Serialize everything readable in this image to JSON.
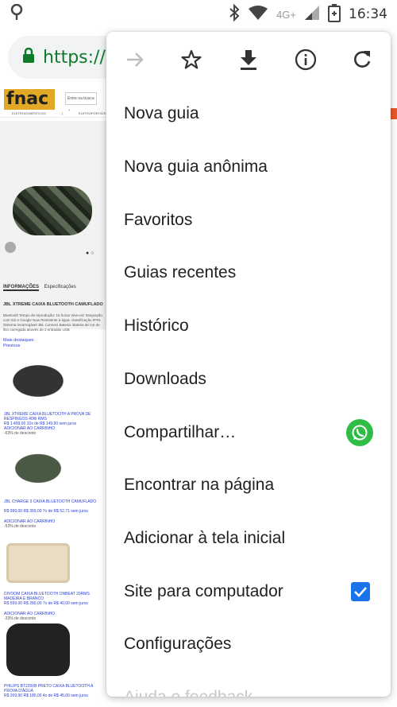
{
  "status_bar": {
    "time": "16:34",
    "network": "4G+",
    "icons": [
      "location-icon",
      "bluetooth-icon",
      "wifi-icon",
      "signal-icon",
      "battery-charging-icon"
    ]
  },
  "address_bar": {
    "url": "https://",
    "secure_icon": "lock-icon"
  },
  "page": {
    "logo": "fnac",
    "search_label": "Entre na busca ⌄",
    "nav": [
      "ELETRODOMÉSTICOS",
      "|",
      "ELETROPORTÁTEIS",
      "|"
    ],
    "tabs": [
      "INFORMAÇÕES",
      "Especificações"
    ],
    "product_title": "JBL XTREME CAIXA BLUETOOTH CAMUFLADO",
    "product_desc": "Bluetooth Tempo de reprodução: 15 horas Viva-voz Integração com Siri e Google Now Resistente à água: classificação IPX5 Sistema recarregável JBL Connect Bateria: Bateria de íon de lítio carregada através de 2 entradas USB",
    "links": [
      "Mais destaques",
      "Previous"
    ],
    "items": [
      {
        "text": "JBL XTREME CAIXA BLUETOOTH A PROVA DE RESPINGOS 40W RMS",
        "price": "R$ 1.499,00 10x de R$ 149,90 sem juros",
        "cart": "ADICIONAR AO CARRINHO",
        "discount": "-63% de desconto"
      },
      {
        "text": "JBL CHARGE 3 CAIXA BLUETOOTH CAMUFLADO",
        "price": "R$ 999,00 R$ 369,00 7x de R$ 52,71 sem juros",
        "cart": "ADICIONAR AO CARRINHO",
        "discount": "-53% de desconto"
      },
      {
        "text": "DIVOOM CAIXA BLUETOOTH ONBEAT 20RMS MADEIRA E BRANCO",
        "price": "R$ 599,00 R$ 280,00 7x de R$ 40,00 sem juros",
        "cart": "ADICIONAR AO CARRINHO",
        "discount": "-33% de desconto"
      },
      {
        "text": "PHILIPS BT2200B PRETO CAIXA BLUETOOTH A PROVA D'ÁGUA",
        "price": "R$ 269,90 R$ 180,00 4x de R$ 45,00 sem juros",
        "cart": "",
        "discount": ""
      }
    ]
  },
  "menu": {
    "top_icons": [
      "forward-icon",
      "bookmark-star-icon",
      "download-icon",
      "info-icon",
      "refresh-icon"
    ],
    "items": [
      {
        "label": "Nova guia"
      },
      {
        "label": "Nova guia anônima"
      },
      {
        "label": "Favoritos"
      },
      {
        "label": "Guias recentes"
      },
      {
        "label": "Histórico"
      },
      {
        "label": "Downloads"
      },
      {
        "label": "Compartilhar…",
        "trailing": "whatsapp-icon"
      },
      {
        "label": "Encontrar na página"
      },
      {
        "label": "Adicionar à tela inicial"
      },
      {
        "label": "Site para computador",
        "checked": true
      },
      {
        "label": "Configurações"
      },
      {
        "label": "Ajuda e feedback"
      }
    ]
  },
  "colors": {
    "accent": "#1a73e8",
    "secure_green": "#0f7a2a",
    "fnac_yellow": "#e1a925",
    "whatsapp_green": "#2fbd46"
  }
}
